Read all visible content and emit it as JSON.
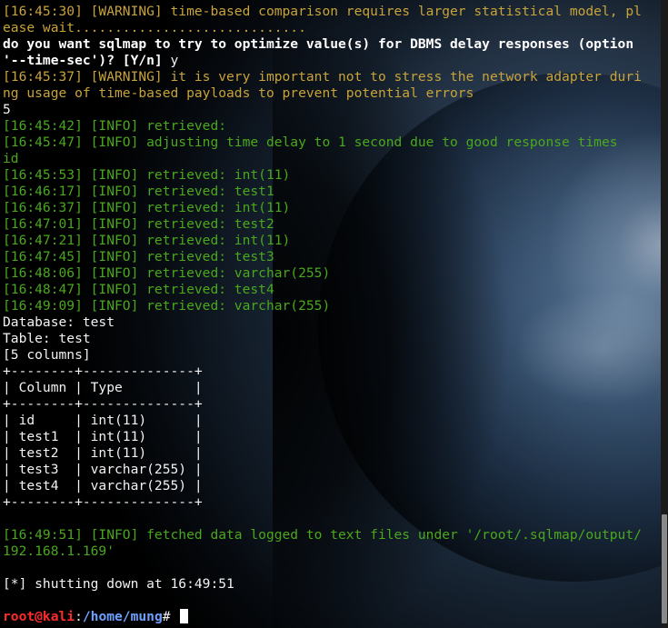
{
  "terminal": {
    "lines": [
      {
        "kind": "warn",
        "text": "[16:45:30] [WARNING] time-based comparison requires larger statistical model, pl"
      },
      {
        "kind": "warn",
        "text": "ease wait............................."
      },
      {
        "kind": "bold",
        "text": "do you want sqlmap to try to optimize value(s) for DBMS delay responses (option"
      },
      {
        "kind": "bold",
        "text": "'--time-sec')? [Y/n] ",
        "answer": "y"
      },
      {
        "kind": "warn",
        "text": "[16:45:37] [WARNING] it is very important not to stress the network adapter duri"
      },
      {
        "kind": "warn",
        "text": "ng usage of time-based payloads to prevent potential errors"
      },
      {
        "kind": "white",
        "text": "5"
      },
      {
        "kind": "info",
        "text": "[16:45:42] [INFO] retrieved: "
      },
      {
        "kind": "info",
        "text": "[16:45:47] [INFO] adjusting time delay to 1 second due to good response times"
      },
      {
        "kind": "info",
        "text": "id"
      },
      {
        "kind": "info",
        "text": "[16:45:53] [INFO] retrieved: int(11)"
      },
      {
        "kind": "info",
        "text": "[16:46:17] [INFO] retrieved: test1"
      },
      {
        "kind": "info",
        "text": "[16:46:37] [INFO] retrieved: int(11)"
      },
      {
        "kind": "info",
        "text": "[16:47:01] [INFO] retrieved: test2"
      },
      {
        "kind": "info",
        "text": "[16:47:21] [INFO] retrieved: int(11)"
      },
      {
        "kind": "info",
        "text": "[16:47:45] [INFO] retrieved: test3"
      },
      {
        "kind": "info",
        "text": "[16:48:06] [INFO] retrieved: varchar(255)"
      },
      {
        "kind": "info",
        "text": "[16:48:47] [INFO] retrieved: test4"
      },
      {
        "kind": "info",
        "text": "[16:49:09] [INFO] retrieved: varchar(255)"
      },
      {
        "kind": "white",
        "text": "Database: test"
      },
      {
        "kind": "white",
        "text": "Table: test"
      },
      {
        "kind": "white",
        "text": "[5 columns]"
      },
      {
        "kind": "white",
        "text": "+--------+--------------+"
      },
      {
        "kind": "white",
        "text": "| Column | Type         |"
      },
      {
        "kind": "white",
        "text": "+--------+--------------+"
      },
      {
        "kind": "white",
        "text": "| id     | int(11)      |"
      },
      {
        "kind": "white",
        "text": "| test1  | int(11)      |"
      },
      {
        "kind": "white",
        "text": "| test2  | int(11)      |"
      },
      {
        "kind": "white",
        "text": "| test3  | varchar(255) |"
      },
      {
        "kind": "white",
        "text": "| test4  | varchar(255) |"
      },
      {
        "kind": "white",
        "text": "+--------+--------------+"
      },
      {
        "kind": "white",
        "text": ""
      },
      {
        "kind": "info",
        "text": "[16:49:51] [INFO] fetched data logged to text files under '/root/.sqlmap/output/"
      },
      {
        "kind": "info",
        "text": "192.168.1.169'"
      },
      {
        "kind": "white",
        "text": ""
      },
      {
        "kind": "white",
        "text": "[*] shutting down at 16:49:51"
      },
      {
        "kind": "white",
        "text": ""
      }
    ],
    "prompt": {
      "user_host": "root@kali",
      "separator": ":",
      "path": "/home/mung",
      "symbol": "# "
    }
  },
  "colors": {
    "warning": "#c8a33a",
    "info": "#4aa81c",
    "text": "#f2f2f2",
    "prompt_user": "#ff2b2b",
    "prompt_path": "#6ea0ff"
  },
  "background": "earth-from-space-wallpaper"
}
